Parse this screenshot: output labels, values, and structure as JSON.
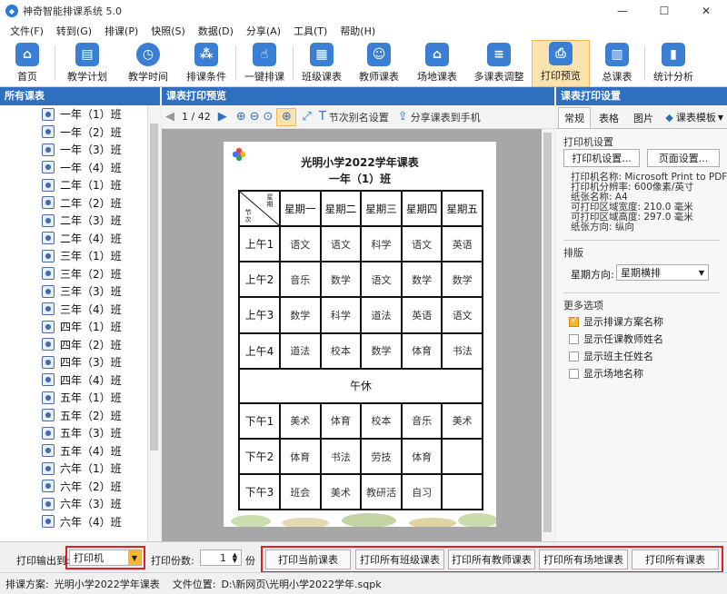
{
  "window": {
    "title": "神奇智能排课系统 5.0"
  },
  "menu": [
    "文件(F)",
    "转到(G)",
    "排课(P)",
    "快照(S)",
    "数据(D)",
    "分享(A)",
    "工具(T)",
    "帮助(H)"
  ],
  "toolbar": [
    {
      "label": "首页",
      "icon": "home-icon",
      "color": "#3a7fd4"
    },
    {
      "label": "教学计划",
      "icon": "book-icon",
      "color": "#3a7fd4"
    },
    {
      "label": "教学时间",
      "icon": "clock-icon",
      "color": "#3a7fd4"
    },
    {
      "label": "排课条件",
      "icon": "nodes-icon",
      "color": "#3a7fd4"
    },
    {
      "label": "一键排课",
      "icon": "hand-icon",
      "color": "#3a7fd4"
    },
    {
      "label": "班级课表",
      "icon": "calendar-icon",
      "color": "#3a7fd4"
    },
    {
      "label": "教师课表",
      "icon": "teacher-icon",
      "color": "#3a7fd4"
    },
    {
      "label": "场地课表",
      "icon": "building-icon",
      "color": "#3a7fd4"
    },
    {
      "label": "多课表调整",
      "icon": "adjust-icon",
      "color": "#3a7fd4"
    },
    {
      "label": "打印预览",
      "icon": "printer-icon",
      "color": "#3a7fd4"
    },
    {
      "label": "总课表",
      "icon": "table-icon",
      "color": "#3a7fd4"
    },
    {
      "label": "统计分析",
      "icon": "chart-icon",
      "color": "#3a7fd4"
    }
  ],
  "left_panel": {
    "title": "所有课表",
    "items": [
      "一年（1）班",
      "一年（2）班",
      "一年（3）班",
      "一年（4）班",
      "二年（1）班",
      "二年（2）班",
      "二年（3）班",
      "二年（4）班",
      "三年（1）班",
      "三年（2）班",
      "三年（3）班",
      "三年（4）班",
      "四年（1）班",
      "四年（2）班",
      "四年（3）班",
      "四年（4）班",
      "五年（1）班",
      "五年（2）班",
      "五年（3）班",
      "五年（4）班",
      "六年（1）班",
      "六年（2）班",
      "六年（3）班",
      "六年（4）班"
    ]
  },
  "preview": {
    "title": "课表打印预览",
    "page_indicator": "1 / 42",
    "alias_label": "节次别名设置",
    "share_label": "分享课表到手机",
    "page_title": "光明小学2022学年课表",
    "page_subtitle": "一年（1）班",
    "corner_top": "星期",
    "corner_bottom": "节次",
    "days": [
      "星期一",
      "星期二",
      "星期三",
      "星期四",
      "星期五"
    ],
    "rows": [
      {
        "label": "上午1",
        "cells": [
          "语文",
          "语文",
          "科学",
          "语文",
          "英语"
        ]
      },
      {
        "label": "上午2",
        "cells": [
          "音乐",
          "数学",
          "语文",
          "数学",
          "数学"
        ]
      },
      {
        "label": "上午3",
        "cells": [
          "数学",
          "科学",
          "道法",
          "英语",
          "语文"
        ]
      },
      {
        "label": "上午4",
        "cells": [
          "道法",
          "校本",
          "数学",
          "体育",
          "书法"
        ]
      },
      {
        "label": "下午1",
        "cells": [
          "美术",
          "体育",
          "校本",
          "音乐",
          "美术"
        ]
      },
      {
        "label": "下午2",
        "cells": [
          "体育",
          "书法",
          "劳技",
          "体育",
          ""
        ]
      },
      {
        "label": "下午3",
        "cells": [
          "班会",
          "美术",
          "教研活",
          "自习",
          ""
        ]
      }
    ],
    "lunch": "午休"
  },
  "settings": {
    "title": "课表打印设置",
    "tabs": [
      "常规",
      "表格",
      "图片"
    ],
    "template_label": "课表模板",
    "printer_group": "打印机设置",
    "printer_btn": "打印机设置...",
    "page_btn": "页面设置...",
    "info": [
      "打印机名称: Microsoft Print to PDF",
      "打印机分辨率: 600像素/英寸",
      "纸张名称: A4",
      "可打印区域宽度: 210.0 毫米",
      "可打印区域高度: 297.0 毫米",
      "纸张方向: 纵向"
    ],
    "layout_group": "排版",
    "week_dir_label": "星期方向:",
    "week_dir_value": "星期横排",
    "more_group": "更多选项",
    "options": [
      {
        "label": "显示排课方案名称",
        "checked": true
      },
      {
        "label": "显示任课教师姓名",
        "checked": false
      },
      {
        "label": "显示班主任姓名",
        "checked": false
      },
      {
        "label": "显示场地名称",
        "checked": false
      }
    ]
  },
  "bottom": {
    "output_label": "打印输出到:",
    "output_value": "打印机",
    "copies_label": "打印份数:",
    "copies_value": "1",
    "copies_unit": "份",
    "buttons": [
      "打印当前课表",
      "打印所有班级课表",
      "打印所有教师课表",
      "打印所有场地课表",
      "打印所有课表"
    ]
  },
  "status": {
    "plan_label": "排课方案:",
    "plan_value": "光明小学2022学年课表",
    "file_label": "文件位置:",
    "file_value": "D:\\新网页\\光明小学2022学年.sqpk"
  }
}
